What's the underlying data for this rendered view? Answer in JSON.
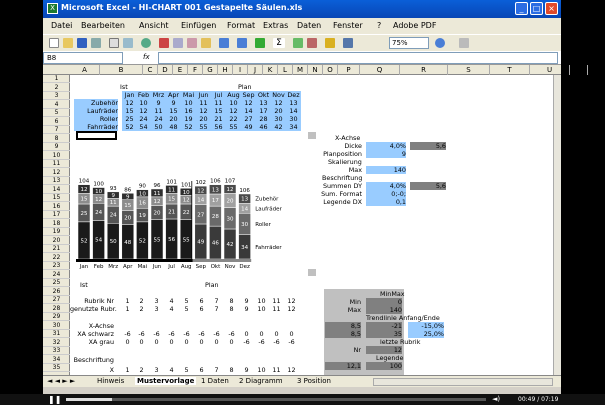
{
  "window": {
    "title": "Microsoft Excel - HI-CHART 001 Gestapelte Säulen.xls",
    "min": "_",
    "max": "□",
    "close": "×"
  },
  "menu": [
    "Datei",
    "Bearbeiten",
    "Ansicht",
    "Einfügen",
    "Format",
    "Extras",
    "Daten",
    "Fenster",
    "?",
    "Adobe PDF"
  ],
  "toolbar": {
    "zoom": "75%"
  },
  "formula": {
    "namebox": "B8",
    "fx": "fx"
  },
  "columns": [
    "A",
    "B",
    "C",
    "D",
    "E",
    "F",
    "G",
    "H",
    "I",
    "J",
    "K",
    "L",
    "M",
    "N",
    "O",
    "P",
    "Q",
    "R",
    "S",
    "T",
    "U",
    "V"
  ],
  "rows": [
    "1",
    "2",
    "3",
    "4",
    "5",
    "6",
    "7",
    "8",
    "9",
    "10",
    "11",
    "12",
    "13",
    "14",
    "15",
    "16",
    "17",
    "18",
    "19",
    "20",
    "21",
    "22",
    "23",
    "24",
    "25",
    "26",
    "27",
    "28",
    "29",
    "30",
    "31",
    "32",
    "33",
    "34",
    "35"
  ],
  "table": {
    "ist": "Ist",
    "plan": "Plan",
    "months": [
      "Jan",
      "Feb",
      "Mrz",
      "Apr",
      "Mai",
      "Jun",
      "Jul",
      "Aug",
      "Sep",
      "Okt",
      "Nov",
      "Dez"
    ],
    "rows": [
      {
        "label": "Zubehör",
        "values": [
          "12",
          "10",
          "9",
          "9",
          "10",
          "11",
          "11",
          "10",
          "12",
          "13",
          "12",
          "13"
        ]
      },
      {
        "label": "Laufräder",
        "values": [
          "15",
          "12",
          "11",
          "15",
          "16",
          "12",
          "15",
          "12",
          "14",
          "17",
          "20",
          "14"
        ]
      },
      {
        "label": "Roller",
        "values": [
          "25",
          "24",
          "24",
          "20",
          "19",
          "20",
          "21",
          "22",
          "27",
          "28",
          "30",
          "30"
        ]
      },
      {
        "label": "Fahrräder",
        "values": [
          "52",
          "54",
          "50",
          "48",
          "52",
          "55",
          "56",
          "55",
          "49",
          "46",
          "42",
          "34"
        ]
      }
    ]
  },
  "side": {
    "xachse": "X-Achse",
    "dicke": "Dicke",
    "dicke_val": "4,0%",
    "dicke_val2": "5,6",
    "planposition": "Planposition",
    "planpos_val": "9",
    "skalierung": "Skalierung",
    "max": "Max",
    "max_val": "140",
    "beschriftung": "Beschriftung",
    "summen": "Summen DY",
    "summen_val": "4,0%",
    "summen_val2": "5,6",
    "sumformat": "Sum. Format",
    "sumformat_val": "0;-0;",
    "legende": "Legende DX",
    "legende_val": "0,1"
  },
  "chart_data": {
    "type": "bar",
    "categories": [
      "Jan",
      "Feb",
      "Mrz",
      "Apr",
      "Mai",
      "Jun",
      "Jul",
      "Aug",
      "Sep",
      "Okt",
      "Nov",
      "Dez"
    ],
    "series": [
      {
        "name": "Fahrräder",
        "values": [
          52,
          54,
          50,
          48,
          52,
          55,
          56,
          55,
          49,
          46,
          42,
          34
        ]
      },
      {
        "name": "Roller",
        "values": [
          25,
          24,
          24,
          20,
          19,
          20,
          21,
          22,
          27,
          28,
          30,
          30
        ]
      },
      {
        "name": "Laufräder",
        "values": [
          15,
          12,
          11,
          15,
          16,
          12,
          15,
          12,
          14,
          17,
          20,
          14
        ]
      },
      {
        "name": "Zubehör",
        "values": [
          12,
          10,
          9,
          9,
          10,
          11,
          11,
          10,
          12,
          13,
          12,
          13
        ]
      }
    ],
    "totals": [
      104,
      100,
      93,
      86,
      90,
      96,
      101,
      101,
      102,
      106,
      107,
      106
    ],
    "ist_label": "Ist",
    "plan_label": "Plan",
    "colors": [
      "#1a1a1a",
      "#555555",
      "#8c8c8c",
      "#2e2e2e"
    ],
    "ylim": [
      0,
      140
    ]
  },
  "lower": {
    "ist": "Ist",
    "plan": "Plan",
    "rubrik": "Rubrik Nr",
    "rubrik_vals": [
      "1",
      "2",
      "3",
      "4",
      "5",
      "6",
      "7",
      "8",
      "9",
      "10",
      "11",
      "12"
    ],
    "genutzte": "genutzte Rubr.",
    "genutzte_vals": [
      "1",
      "2",
      "3",
      "4",
      "5",
      "6",
      "7",
      "8",
      "9",
      "10",
      "11",
      "12"
    ],
    "xachse": "X-Achse",
    "xaschwarz": "XA schwarz",
    "xaschwarz_vals": [
      "-6",
      "-6",
      "-6",
      "-6",
      "-6",
      "-6",
      "-6",
      "-6",
      "0",
      "0",
      "0",
      "0"
    ],
    "xagrau": "XA grau",
    "xagrau_vals": [
      "0",
      "0",
      "0",
      "0",
      "0",
      "0",
      "0",
      "0",
      "-6",
      "-6",
      "-6",
      "-6"
    ],
    "beschriftung": "Beschriftung",
    "x": "X",
    "x_vals": [
      "1",
      "2",
      "3",
      "4",
      "5",
      "6",
      "7",
      "8",
      "9",
      "10",
      "11",
      "12"
    ],
    "minmax": "MinMax",
    "min": "Min",
    "min_val": "0",
    "maxl": "Max",
    "max_val": "140",
    "trend": "Trendlinie Anfang/Ende",
    "t1a": "8,5",
    "t1b": "-21",
    "t1c": "-15,0%",
    "t2a": "8,5",
    "t2b": "35",
    "t2c": "25,0%",
    "letzte": "letzte Rubrik",
    "nr": "Nr",
    "nr_val": "12",
    "legende": "Legende",
    "l1": "12,1",
    "l2": "100"
  },
  "tabs": [
    "Hinweis",
    "Mustervorlage",
    "1 Daten",
    "2 Diagramm",
    "3 Position"
  ],
  "player": {
    "time": "00:49 / 07:19"
  }
}
